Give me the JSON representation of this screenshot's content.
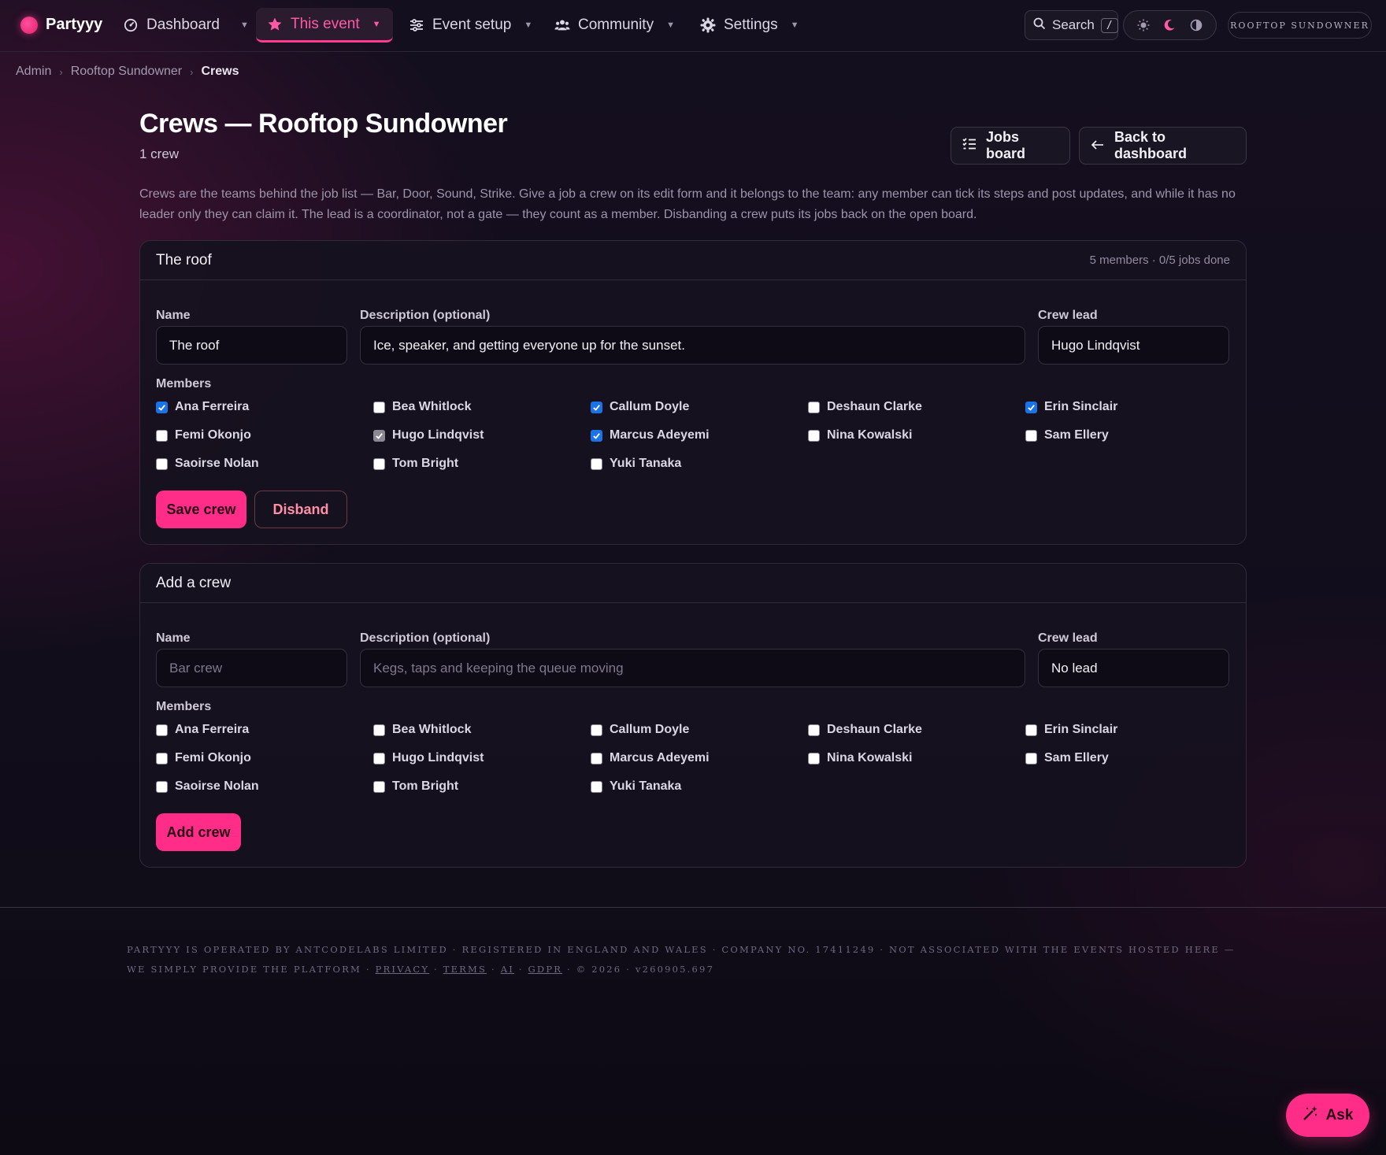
{
  "brand": {
    "name": "Partyyy"
  },
  "nav": {
    "dashboard": "Dashboard",
    "this_event": "This event",
    "event_setup": "Event setup",
    "community": "Community",
    "settings": "Settings",
    "search": "Search",
    "search_kbd": "/",
    "event_pill": "ROOFTOP SUNDOWNER"
  },
  "breadcrumb": {
    "admin": "Admin",
    "event": "Rooftop Sundowner",
    "current": "Crews"
  },
  "header": {
    "title": "Crews — Rooftop Sundowner",
    "subtitle": "1 crew",
    "jobs_board": "Jobs board",
    "back_to_dashboard": "Back to dashboard"
  },
  "intro": "Crews are the teams behind the job list — Bar, Door, Sound, Strike. Give a job a crew on its edit form and it belongs to the team: any member can tick its steps and post updates, and while it has no leader only they can claim it. The lead is a coordinator, not a gate — they count as a member. Disbanding a crew puts its jobs back on the open board.",
  "crew_card": {
    "title": "The roof",
    "meta": "5 members · 0/5 jobs done",
    "name_label": "Name",
    "name_value": "The roof",
    "desc_label": "Description (optional)",
    "desc_value": "Ice, speaker, and getting everyone up for the sunset.",
    "lead_label": "Crew lead",
    "lead_value": "Hugo Lindqvist",
    "members_label": "Members",
    "members": [
      {
        "name": "Ana Ferreira",
        "state": "checked"
      },
      {
        "name": "Bea Whitlock",
        "state": "unchecked"
      },
      {
        "name": "Callum Doyle",
        "state": "checked"
      },
      {
        "name": "Deshaun Clarke",
        "state": "unchecked"
      },
      {
        "name": "Erin Sinclair",
        "state": "checked"
      },
      {
        "name": "Femi Okonjo",
        "state": "unchecked"
      },
      {
        "name": "Hugo Lindqvist",
        "state": "disabled-checked"
      },
      {
        "name": "Marcus Adeyemi",
        "state": "checked"
      },
      {
        "name": "Nina Kowalski",
        "state": "unchecked"
      },
      {
        "name": "Sam Ellery",
        "state": "unchecked"
      },
      {
        "name": "Saoirse Nolan",
        "state": "unchecked"
      },
      {
        "name": "Tom Bright",
        "state": "unchecked"
      },
      {
        "name": "Yuki Tanaka",
        "state": "unchecked"
      }
    ],
    "save_label": "Save crew",
    "disband_label": "Disband"
  },
  "add_card": {
    "title": "Add a crew",
    "name_label": "Name",
    "name_placeholder": "Bar crew",
    "desc_label": "Description (optional)",
    "desc_placeholder": "Kegs, taps and keeping the queue moving",
    "lead_label": "Crew lead",
    "lead_value": "No lead",
    "members_label": "Members",
    "members": [
      {
        "name": "Ana Ferreira",
        "state": "unchecked"
      },
      {
        "name": "Bea Whitlock",
        "state": "unchecked"
      },
      {
        "name": "Callum Doyle",
        "state": "unchecked"
      },
      {
        "name": "Deshaun Clarke",
        "state": "unchecked"
      },
      {
        "name": "Erin Sinclair",
        "state": "unchecked"
      },
      {
        "name": "Femi Okonjo",
        "state": "unchecked"
      },
      {
        "name": "Hugo Lindqvist",
        "state": "unchecked"
      },
      {
        "name": "Marcus Adeyemi",
        "state": "unchecked"
      },
      {
        "name": "Nina Kowalski",
        "state": "unchecked"
      },
      {
        "name": "Sam Ellery",
        "state": "unchecked"
      },
      {
        "name": "Saoirse Nolan",
        "state": "unchecked"
      },
      {
        "name": "Tom Bright",
        "state": "unchecked"
      },
      {
        "name": "Yuki Tanaka",
        "state": "unchecked"
      }
    ],
    "add_label": "Add crew"
  },
  "footer": {
    "line1": "Partyyy is operated by AntCodeLabs Limited · Registered in England and Wales · Company No. 17411249 · Not associated with the events hosted here —",
    "line2_prefix": "we simply provide the platform ·",
    "privacy": "Privacy",
    "terms": "Terms",
    "ai": "AI",
    "gdpr": "GDPR",
    "dot": "·",
    "copyright": "· © 2026 · v260905.697"
  },
  "ask": {
    "label": "Ask"
  },
  "colors": {
    "accent": "#ff2d87",
    "checkbox_blue": "#1a73e8",
    "background": "#140f1f"
  }
}
